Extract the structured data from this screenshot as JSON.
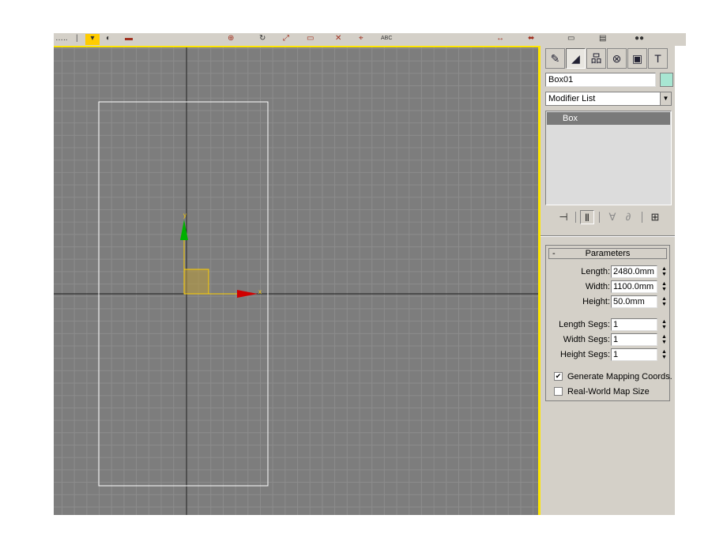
{
  "toolbar": {
    "glyphs": [
      "…",
      "▾",
      "◐",
      "▬",
      "⊕",
      "↻",
      "⤢",
      "▭",
      "✕",
      "⌖",
      "ABC",
      "↔",
      "⬌",
      "▭",
      "▤",
      "●●"
    ]
  },
  "viewport": {
    "axis_x_label": "x",
    "axis_y_label": "y",
    "colors": {
      "background": "#7d7d7d",
      "grid": "#8c8c8c",
      "active_border": "#ffe600",
      "object_outline": "#ffffff",
      "x_axis": "#cc0000",
      "y_axis": "#00aa00",
      "plane_handle": "#ffd000"
    }
  },
  "command_panel": {
    "tabs": [
      {
        "name": "create",
        "icon": "pointer-star-icon"
      },
      {
        "name": "modify",
        "icon": "bend-curve-icon"
      },
      {
        "name": "hierarchy",
        "icon": "hierarchy-icon"
      },
      {
        "name": "motion",
        "icon": "motion-wheel-icon"
      },
      {
        "name": "display",
        "icon": "monitor-icon"
      },
      {
        "name": "utilities",
        "icon": "hammer-icon"
      }
    ],
    "object_name": "Box01",
    "object_color": "#a8e6d2",
    "modifier_list": "Modifier List",
    "stack_items": [
      "Box"
    ],
    "stack_tools": [
      "pin-stack-icon",
      "show-end-result-icon",
      "make-unique-icon",
      "remove-modifier-icon",
      "configure-modifier-sets-icon"
    ],
    "parameters": {
      "title": "Parameters",
      "toggle": "-",
      "length_label": "Length:",
      "length_value": "2480.0mm",
      "width_label": "Width:",
      "width_value": "1100.0mm",
      "height_label": "Height:",
      "height_value": "50.0mm",
      "length_segs_label": "Length Segs:",
      "length_segs_value": "1",
      "width_segs_label": "Width Segs:",
      "width_segs_value": "1",
      "height_segs_label": "Height Segs:",
      "height_segs_value": "1",
      "generate_mapping_label": "Generate Mapping Coords.",
      "generate_mapping_checked": true,
      "real_world_label": "Real-World Map Size",
      "real_world_checked": false
    }
  }
}
